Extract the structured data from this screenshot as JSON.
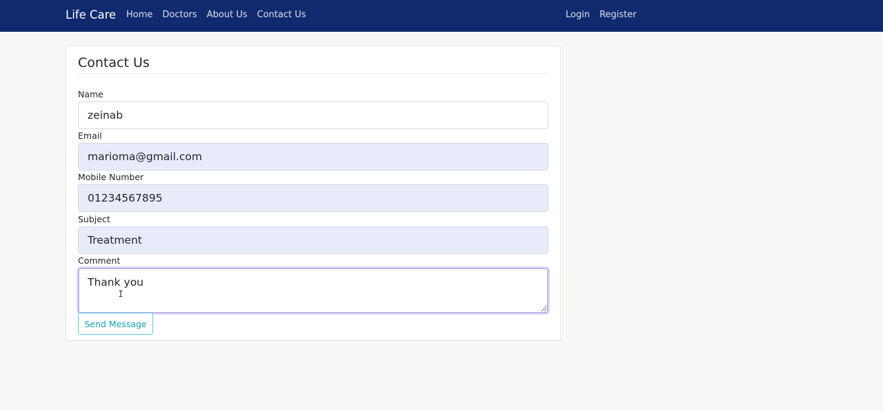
{
  "navbar": {
    "brand": "Life Care",
    "links": [
      {
        "label": "Home"
      },
      {
        "label": "Doctors"
      },
      {
        "label": "About Us"
      },
      {
        "label": "Contact Us"
      }
    ],
    "right_links": [
      {
        "label": "Login"
      },
      {
        "label": "Register"
      }
    ]
  },
  "form": {
    "title": "Contact Us",
    "name": {
      "label": "Name",
      "value": "zeinab"
    },
    "email": {
      "label": "Email",
      "value": "marioma@gmail.com"
    },
    "mobile": {
      "label": "Mobile Number",
      "value": "01234567895"
    },
    "subject": {
      "label": "Subject",
      "value": "Treatment"
    },
    "comment": {
      "label": "Comment",
      "value": "Thank you"
    },
    "submit_label": "Send Message"
  },
  "icons": {
    "cursor": "text-cursor-icon"
  }
}
